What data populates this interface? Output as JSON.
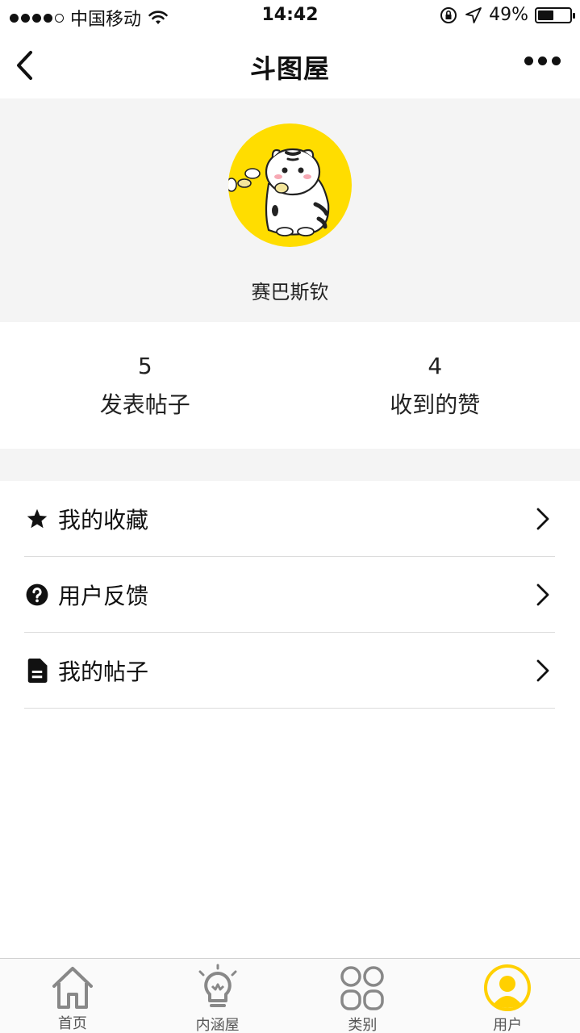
{
  "status_bar": {
    "carrier": "中国移动",
    "time": "14:42",
    "battery": "49%",
    "battery_level": 0.49
  },
  "nav": {
    "title": "斗图屋",
    "back_icon": "chevron-left-icon",
    "more_icon": "more-dots-icon"
  },
  "profile": {
    "username": "赛巴斯钦",
    "avatar_bg": "#ffdd00"
  },
  "stats": [
    {
      "value": "5",
      "label": "发表帖子"
    },
    {
      "value": "4",
      "label": "收到的赞"
    }
  ],
  "menu": [
    {
      "label": "我的收藏",
      "icon": "star-icon"
    },
    {
      "label": "用户反馈",
      "icon": "question-circle-icon"
    },
    {
      "label": "我的帖子",
      "icon": "document-icon"
    }
  ],
  "tabbar": [
    {
      "label": "首页",
      "icon": "home-icon",
      "active": false
    },
    {
      "label": "内涵屋",
      "icon": "lightbulb-icon",
      "active": false
    },
    {
      "label": "类别",
      "icon": "category-grid-icon",
      "active": false
    },
    {
      "label": "用户",
      "icon": "user-icon",
      "active": true
    }
  ],
  "colors": {
    "accent": "#ffd000",
    "panel_bg": "#f4f4f4",
    "divider": "#dcdcdc"
  }
}
